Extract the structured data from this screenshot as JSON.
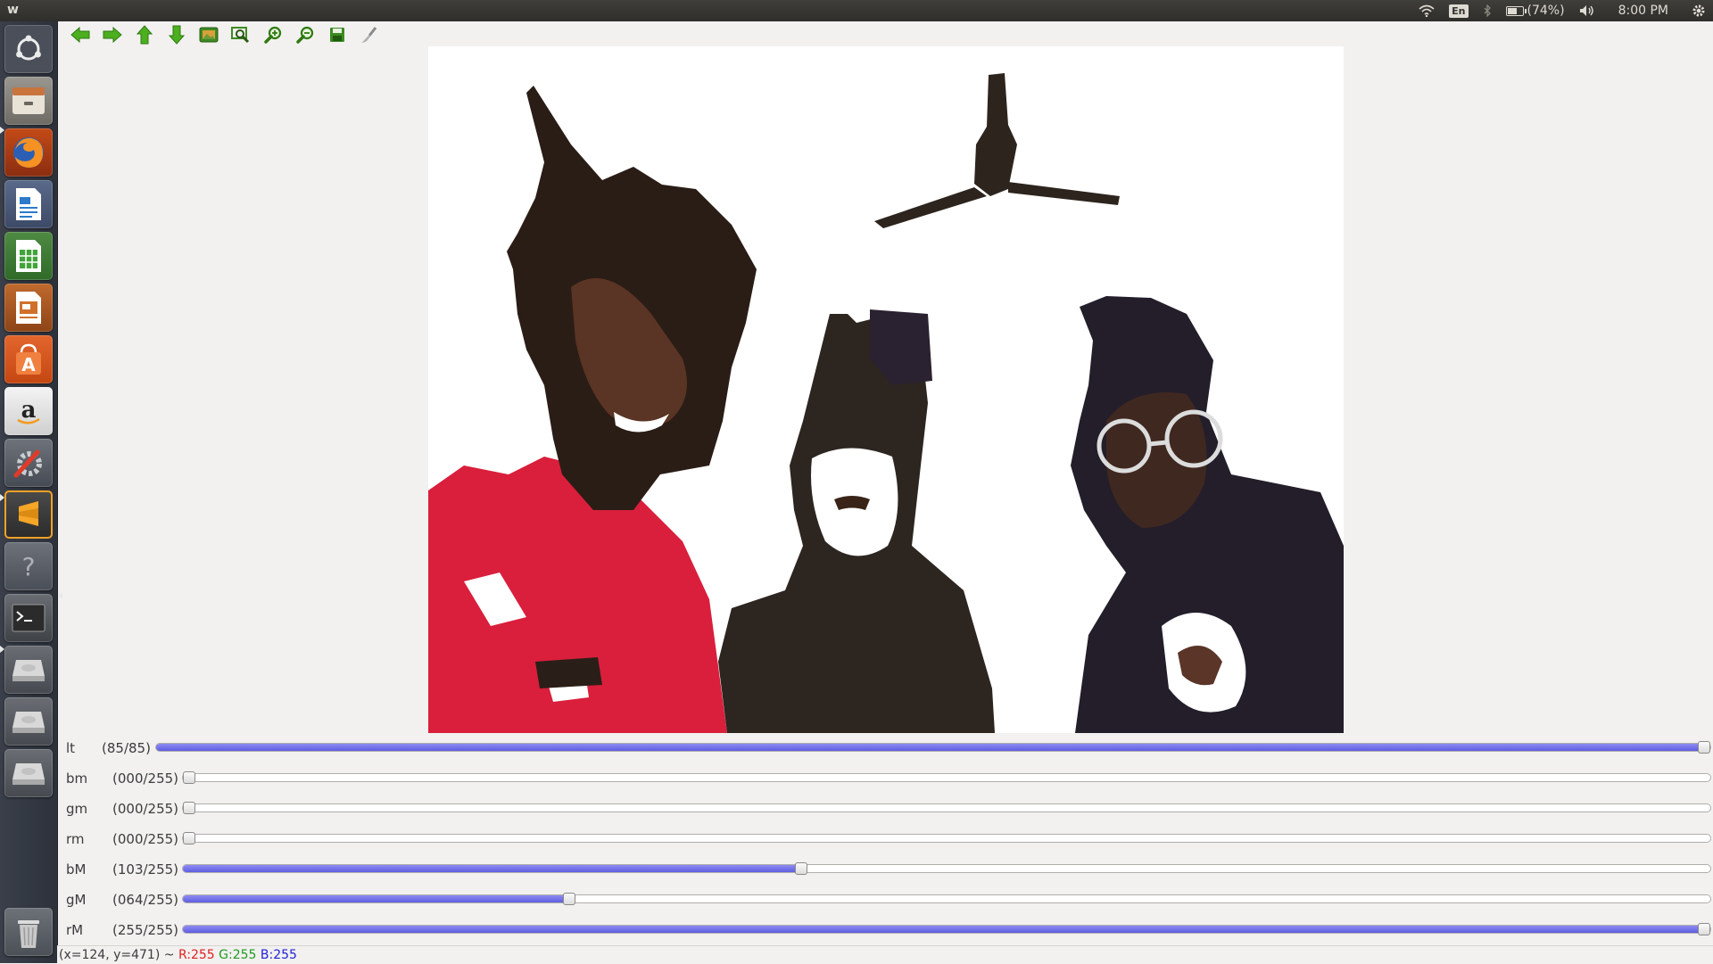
{
  "window": {
    "title": "w"
  },
  "panel": {
    "keyboard_layout": "En",
    "battery_percent": 0.74,
    "battery_text": "(74%)",
    "clock": "8:00 PM"
  },
  "launcher": {
    "items": [
      "dash-home",
      "files",
      "firefox",
      "libreoffice-writer",
      "libreoffice-calc",
      "libreoffice-impress",
      "ubuntu-software",
      "amazon",
      "system-settings",
      "sublime-text",
      "help",
      "terminal",
      "drive",
      "drive",
      "drive",
      "trash"
    ]
  },
  "toolbar": {
    "buttons": [
      "pan-left",
      "pan-right",
      "pan-up",
      "pan-down",
      "zoom-reset",
      "zoom-fit",
      "zoom-in",
      "zoom-out",
      "save",
      "properties"
    ]
  },
  "trackbars": [
    {
      "name": "lt",
      "value_text": "(85/85)",
      "value": 85,
      "max": 85
    },
    {
      "name": "bm",
      "value_text": "(000/255)",
      "value": 0,
      "max": 255
    },
    {
      "name": "gm",
      "value_text": "(000/255)",
      "value": 0,
      "max": 255
    },
    {
      "name": "rm",
      "value_text": "(000/255)",
      "value": 0,
      "max": 255
    },
    {
      "name": "bM",
      "value_text": "(103/255)",
      "value": 103,
      "max": 255
    },
    {
      "name": "gM",
      "value_text": "(064/255)",
      "value": 64,
      "max": 255
    },
    {
      "name": "rM",
      "value_text": "(255/255)",
      "value": 255,
      "max": 255
    }
  ],
  "status": {
    "coords": "(x=124, y=471) ~",
    "r": "R:255",
    "g": "G:255",
    "b": "B:255"
  },
  "colors": {
    "track_fill": "#6f6de8",
    "r": "#e02020",
    "g": "#1f9a1f",
    "b": "#2020d8"
  }
}
